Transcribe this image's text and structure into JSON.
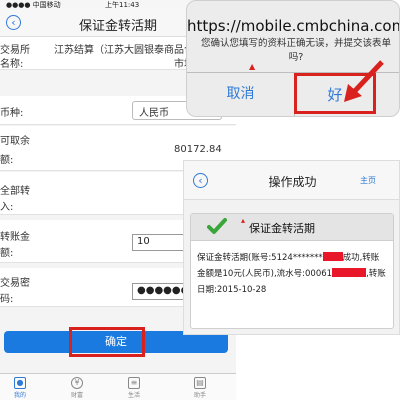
{
  "left": {
    "status": {
      "carrier": "●●●● 中国移动",
      "time": "上午11:43"
    },
    "nav_title": "保证金转活期",
    "rows": {
      "exchange_label": "交易所",
      "exchange_value": "江苏结算（江苏大圆银泰商品合",
      "name_label": "名称:",
      "name_value": "市场有限",
      "currency_label": "币种:",
      "currency_value": "人民币",
      "available_label": "可取余",
      "available_label2": "额:",
      "available_value": "80172.84",
      "all_label": "全部转",
      "all_label2": "入:",
      "amount_label": "转账金",
      "amount_label2": "额:",
      "amount_value": "10",
      "password_label": "交易密",
      "password_label2": "码:",
      "password_value": "●●●●●●"
    },
    "confirm_label": "确定",
    "tabs": [
      {
        "label": "我的",
        "icon": "person-icon"
      },
      {
        "label": "财富",
        "icon": "yen-icon"
      },
      {
        "label": "生活",
        "icon": "cart-icon"
      },
      {
        "label": "助手",
        "icon": "briefcase-icon"
      }
    ]
  },
  "dialog": {
    "host": "https://mobile.cmbchina.com",
    "message": "您确认您填写的资料正确无误，并提交该表单吗?",
    "cancel_label": "取消",
    "ok_label": "好"
  },
  "result": {
    "nav_title": "操作成功",
    "home_label": "主页",
    "card_title": "保证金转活期",
    "line1_a": "保证金转活期(账号:5124*******",
    "line1_b": "成功,转账",
    "line2_a": "金额是10元(人民币),流水号:00061",
    "line2_b": ",转账",
    "line3": "日期:2015-10-28"
  },
  "colors": {
    "accent": "#1a7adf",
    "highlight": "#d9221e",
    "redaction": "#e8182a"
  }
}
